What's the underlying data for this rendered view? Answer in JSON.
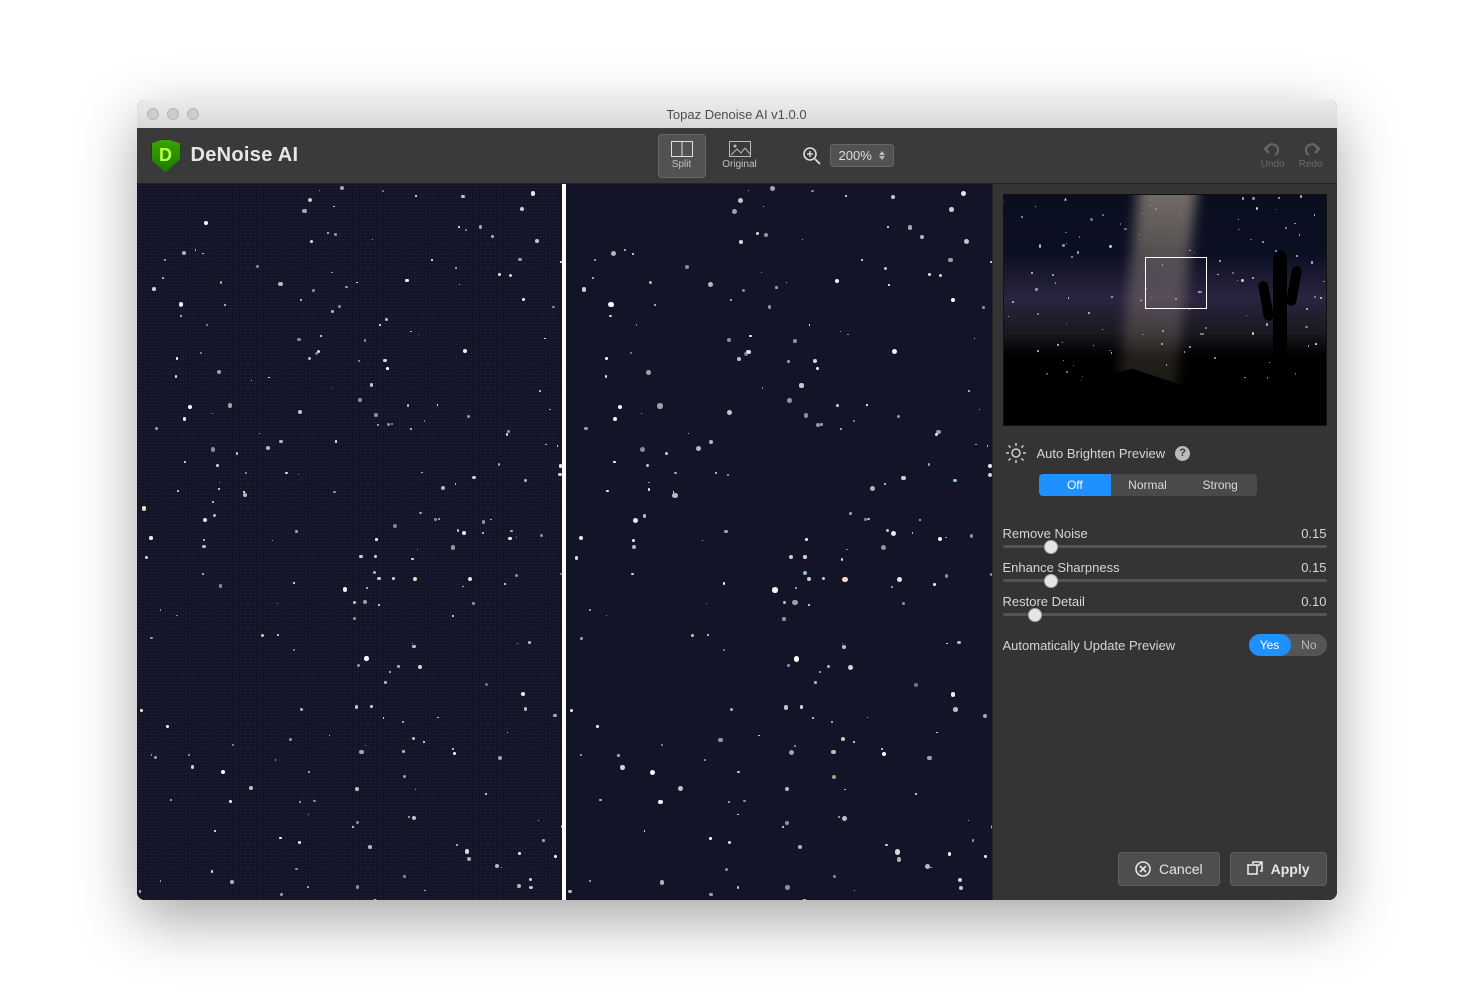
{
  "window": {
    "title": "Topaz Denoise AI v1.0.0"
  },
  "app": {
    "name": "DeNoise AI",
    "logo_letter": "D"
  },
  "toolbar": {
    "view_split": "Split",
    "view_original": "Original",
    "zoom": "200%",
    "undo": "Undo",
    "redo": "Redo"
  },
  "brighten": {
    "label": "Auto Brighten Preview",
    "options": {
      "off": "Off",
      "normal": "Normal",
      "strong": "Strong"
    },
    "active": "off"
  },
  "sliders": {
    "remove_noise": {
      "label": "Remove Noise",
      "value_text": "0.15",
      "fraction": 0.15
    },
    "enhance_sharpness": {
      "label": "Enhance Sharpness",
      "value_text": "0.15",
      "fraction": 0.15
    },
    "restore_detail": {
      "label": "Restore Detail",
      "value_text": "0.10",
      "fraction": 0.1
    }
  },
  "auto_update": {
    "label": "Automatically Update Preview",
    "yes": "Yes",
    "no": "No",
    "value": true
  },
  "buttons": {
    "cancel": "Cancel",
    "apply": "Apply"
  }
}
